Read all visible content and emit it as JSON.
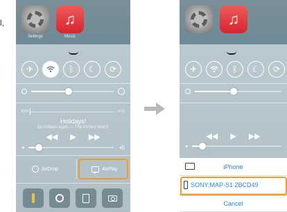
{
  "stray_text": "l,",
  "left_phone": {
    "apps": [
      {
        "label": "Settings",
        "icon": "settings-gear-icon"
      },
      {
        "label": "Music",
        "icon": "music-note-icon"
      }
    ],
    "toggles": [
      {
        "icon": "airplane-icon",
        "state": "off"
      },
      {
        "icon": "wifi-icon",
        "state": "on"
      },
      {
        "icon": "bluetooth-icon",
        "state": "off"
      },
      {
        "icon": "moon-icon",
        "state": "off"
      },
      {
        "icon": "rotation-lock-icon",
        "state": "off"
      }
    ],
    "brightness_level": 0.45,
    "music": {
      "elapsed": "0:00",
      "remaining": "-0:11",
      "title": "Holidays!",
      "subtitle": "Be brilliant again — The Perfect Match",
      "prev_glyph": "◀◀",
      "play_glyph": "▶",
      "next_glyph": "▶▶",
      "volume_level": 0.12
    },
    "share": {
      "airdrop_label": "AirDrop",
      "airplay_label": "AirPlay"
    },
    "highlight_color": "#f19a2a"
  },
  "right_phone": {
    "sheet": {
      "rows": [
        {
          "label": "iPhone",
          "icon": "iphone-icon"
        },
        {
          "label": "SONY:MAP-S1 2BCD49",
          "icon": "speaker-device-icon"
        }
      ],
      "cancel_label": "Cancel"
    },
    "link_color": "#2c82e6"
  }
}
